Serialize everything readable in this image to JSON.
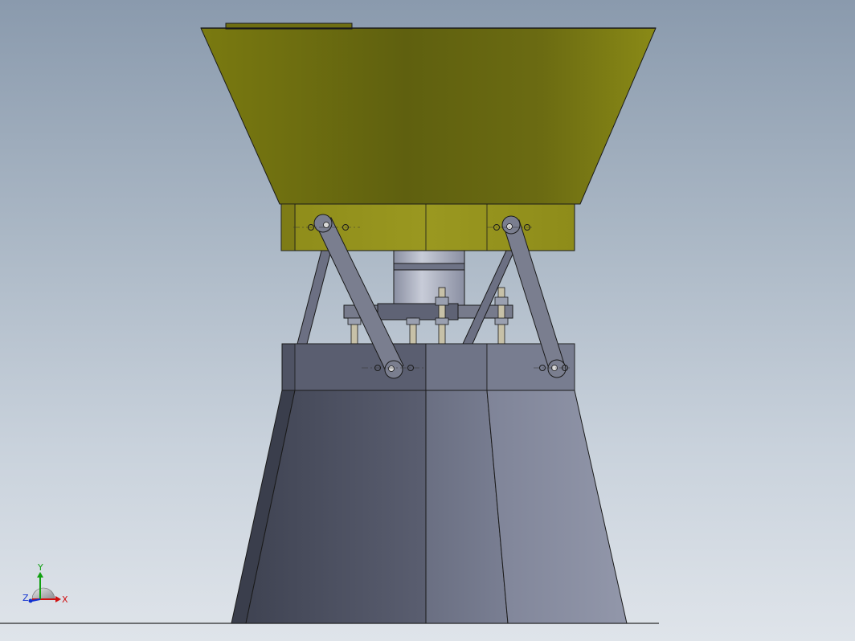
{
  "scene": {
    "view": "front",
    "colors": {
      "hopper_yellow": "#8a8a14",
      "hopper_dark": "#5e5f10",
      "base_grey": "#6b7085",
      "base_light": "#8a90a3",
      "base_dark": "#4f5364",
      "link_grey": "#777b8c",
      "edge": "#1a1a1a",
      "axis_x": "#d01010",
      "axis_y": "#10a010",
      "axis_z": "#1030d0"
    }
  },
  "triad": {
    "x_label": "X",
    "y_label": "Y",
    "z_label": "Z"
  }
}
